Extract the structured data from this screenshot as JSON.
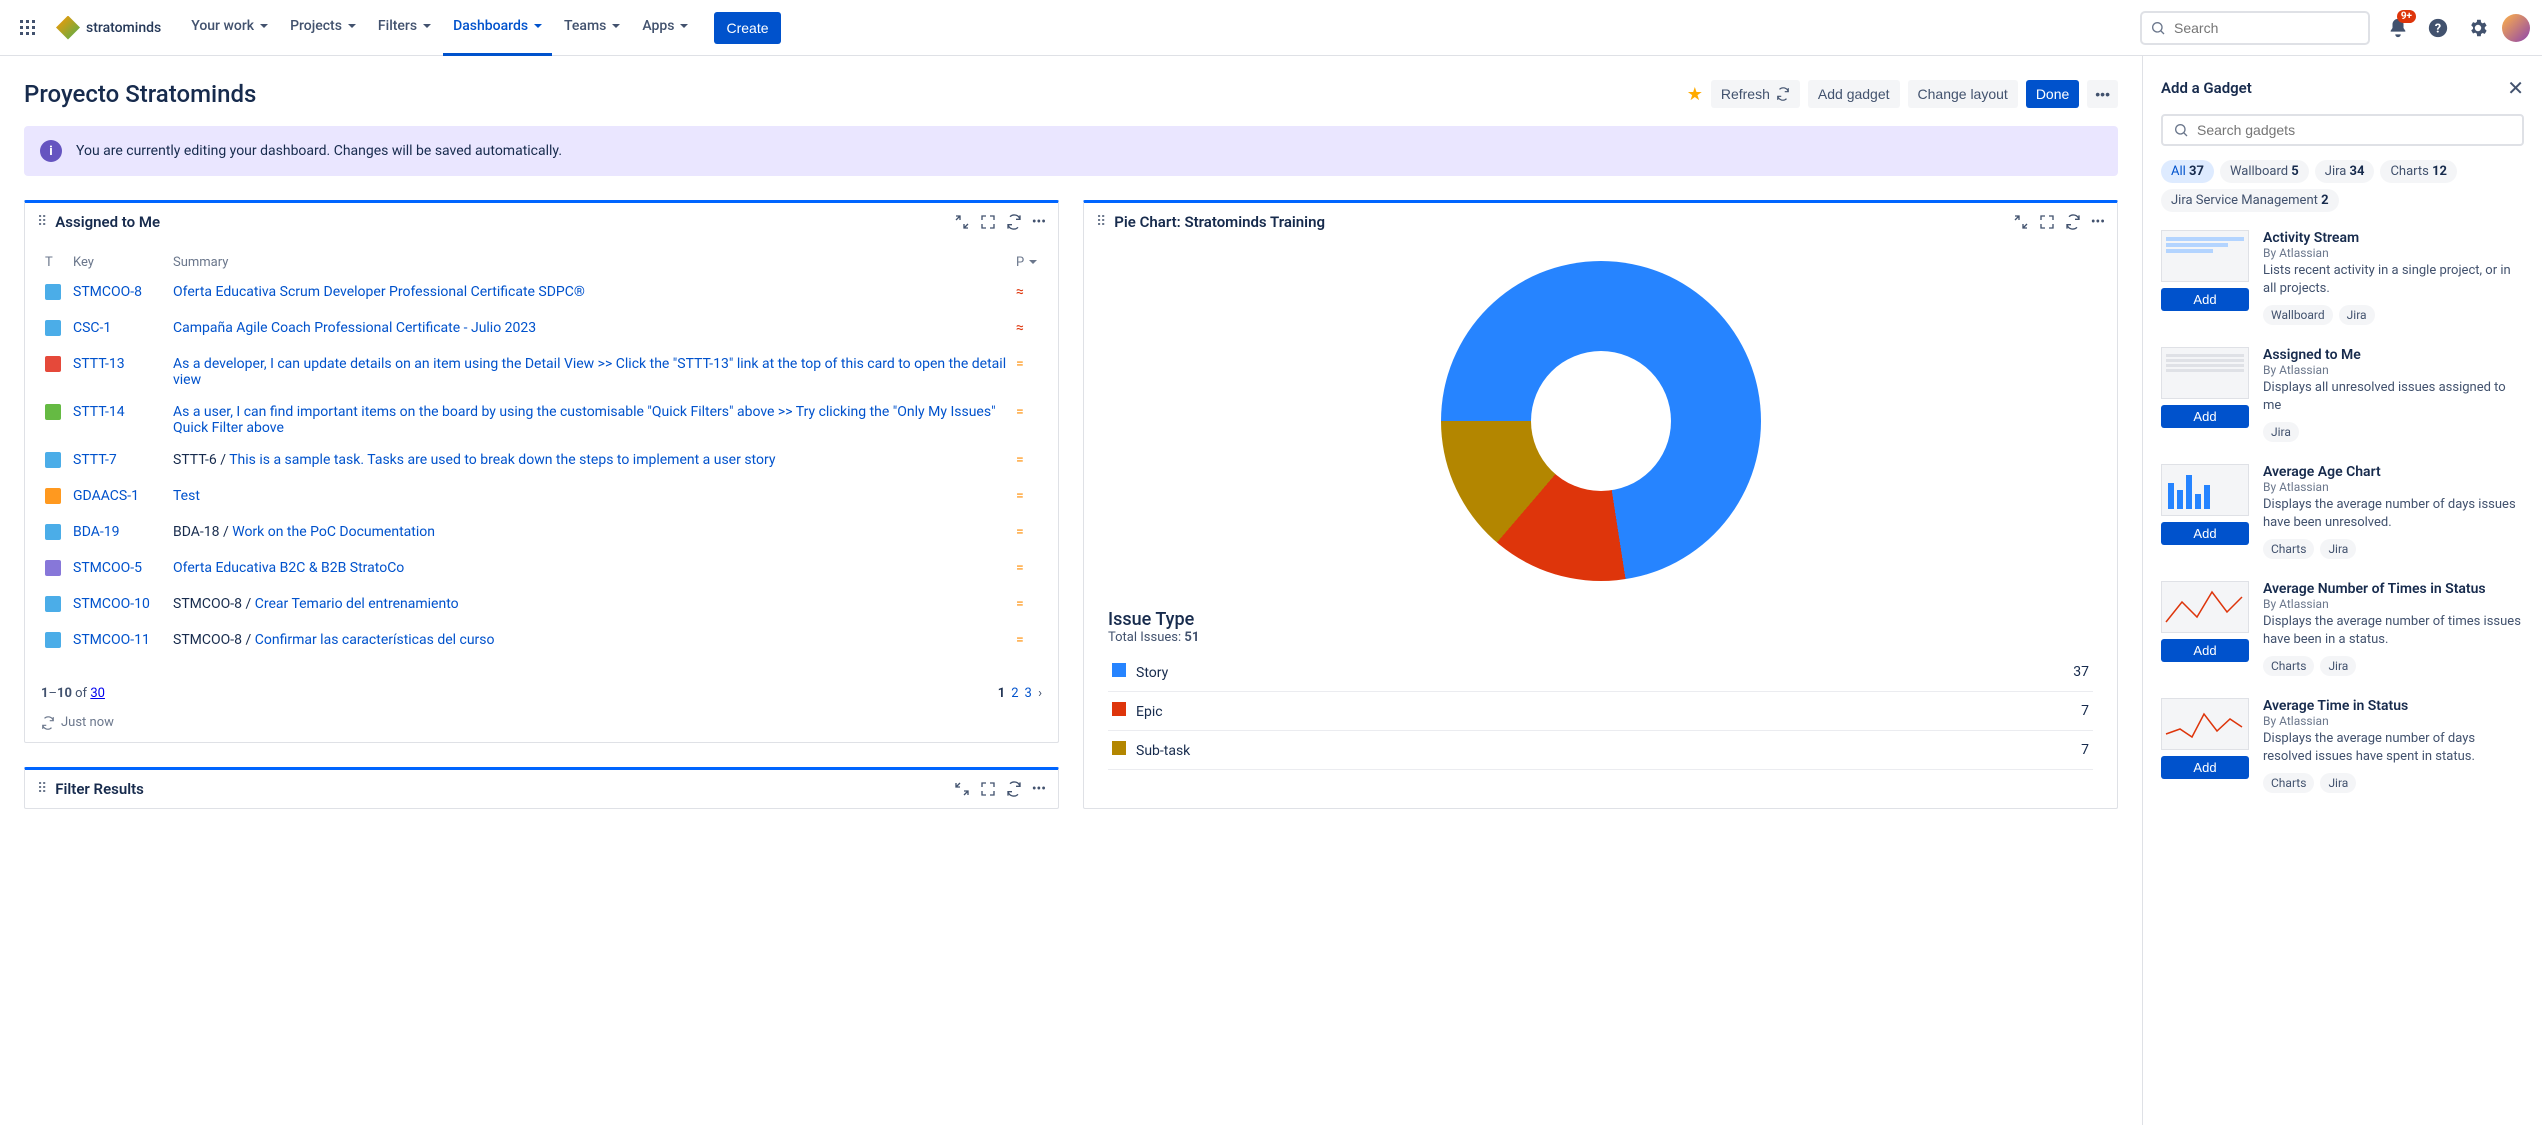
{
  "nav": {
    "items": [
      {
        "label": "Your work",
        "active": false
      },
      {
        "label": "Projects",
        "active": false
      },
      {
        "label": "Filters",
        "active": false
      },
      {
        "label": "Dashboards",
        "active": true
      },
      {
        "label": "Teams",
        "active": false
      },
      {
        "label": "Apps",
        "active": false
      }
    ],
    "create_label": "Create",
    "search_placeholder": "Search",
    "notification_badge": "9+",
    "logo_text": "stratominds"
  },
  "page": {
    "title": "Proyecto Stratominds",
    "buttons": {
      "refresh": "Refresh",
      "add_gadget": "Add gadget",
      "change_layout": "Change layout",
      "done": "Done"
    },
    "banner": "You are currently editing your dashboard. Changes will be saved automatically."
  },
  "assigned": {
    "title": "Assigned to Me",
    "columns": {
      "t": "T",
      "key": "Key",
      "summary": "Summary",
      "p": "P"
    },
    "rows": [
      {
        "type": "task",
        "key": "STMCOO-8",
        "summary": "Oferta Educativa Scrum Developer Professional Certificate SDPC®",
        "link": true,
        "prio": "highest"
      },
      {
        "type": "task",
        "key": "CSC-1",
        "summary": "Campaña Agile Coach Professional Certificate - Julio 2023",
        "link": true,
        "prio": "highest"
      },
      {
        "type": "bug",
        "key": "STTT-13",
        "summary": "As a developer, I can update details on an item using the Detail View >> Click the \"STTT-13\" link at the top of this card to open the detail view",
        "link": true,
        "prio": "medium"
      },
      {
        "type": "story",
        "key": "STTT-14",
        "summary": "As a user, I can find important items on the board by using the customisable \"Quick Filters\" above >> Try clicking the \"Only My Issues\" Quick Filter above",
        "link": true,
        "prio": "medium"
      },
      {
        "type": "subtask",
        "key": "STTT-7",
        "prefix": "STTT-6 / ",
        "summary": "This is a sample task. Tasks are used to break down the steps to implement a user story",
        "link": true,
        "prio": "medium"
      },
      {
        "type": "risk",
        "key": "GDAACS-1",
        "summary": "Test",
        "link": true,
        "prio": "medium"
      },
      {
        "type": "subtask",
        "key": "BDA-19",
        "prefix": "BDA-18 / ",
        "summary": "Work on the PoC Documentation",
        "link": true,
        "prio": "medium"
      },
      {
        "type": "epic",
        "key": "STMCOO-5",
        "summary": "Oferta Educativa B2C & B2B StratoCo",
        "link": true,
        "prio": "medium"
      },
      {
        "type": "subtask",
        "key": "STMCOO-10",
        "prefix": "STMCOO-8 / ",
        "summary": "Crear Temario del entrenamiento",
        "link": true,
        "prio": "medium"
      },
      {
        "type": "subtask",
        "key": "STMCOO-11",
        "prefix": "STMCOO-8 / ",
        "summary": "Confirmar las características del curso",
        "link": true,
        "prio": "medium"
      }
    ],
    "footer": {
      "range_a": "1",
      "range_b": "10",
      "of_label": " of ",
      "total": "30",
      "pages": [
        "1",
        "2",
        "3"
      ],
      "just_now": "Just now"
    }
  },
  "pie": {
    "title": "Pie Chart: Stratominds Training",
    "legend_title": "Issue Type",
    "total_label": "Total Issues: ",
    "total_value": "51"
  },
  "chart_data": {
    "type": "pie",
    "title": "Issue Type",
    "series": [
      {
        "name": "Story",
        "value": 37,
        "color": "#2684FF"
      },
      {
        "name": "Epic",
        "value": 7,
        "color": "#DE350B"
      },
      {
        "name": "Sub-task",
        "value": 7,
        "color": "#B38600"
      }
    ],
    "total": 51
  },
  "filter_results": {
    "title": "Filter Results"
  },
  "sidebar": {
    "title": "Add a Gadget",
    "search_placeholder": "Search gadgets",
    "filters": [
      {
        "label": "All",
        "count": "37",
        "active": true
      },
      {
        "label": "Wallboard",
        "count": "5"
      },
      {
        "label": "Jira",
        "count": "34"
      },
      {
        "label": "Charts",
        "count": "12"
      },
      {
        "label": "Jira Service Management",
        "count": "2"
      }
    ],
    "add_label": "Add",
    "gadgets": [
      {
        "title": "Activity Stream",
        "by": "By Atlassian",
        "desc": "Lists recent activity in a single project, or in all projects.",
        "tags": [
          "Wallboard",
          "Jira"
        ]
      },
      {
        "title": "Assigned to Me",
        "by": "By Atlassian",
        "desc": "Displays all unresolved issues assigned to me",
        "tags": [
          "Jira"
        ]
      },
      {
        "title": "Average Age Chart",
        "by": "By Atlassian",
        "desc": "Displays the average number of days issues have been unresolved.",
        "tags": [
          "Charts",
          "Jira"
        ]
      },
      {
        "title": "Average Number of Times in Status",
        "by": "By Atlassian",
        "desc": "Displays the average number of times issues have been in a status.",
        "tags": [
          "Charts",
          "Jira"
        ]
      },
      {
        "title": "Average Time in Status",
        "by": "By Atlassian",
        "desc": "Displays the average number of days resolved issues have spent in status.",
        "tags": [
          "Charts",
          "Jira"
        ]
      }
    ]
  }
}
